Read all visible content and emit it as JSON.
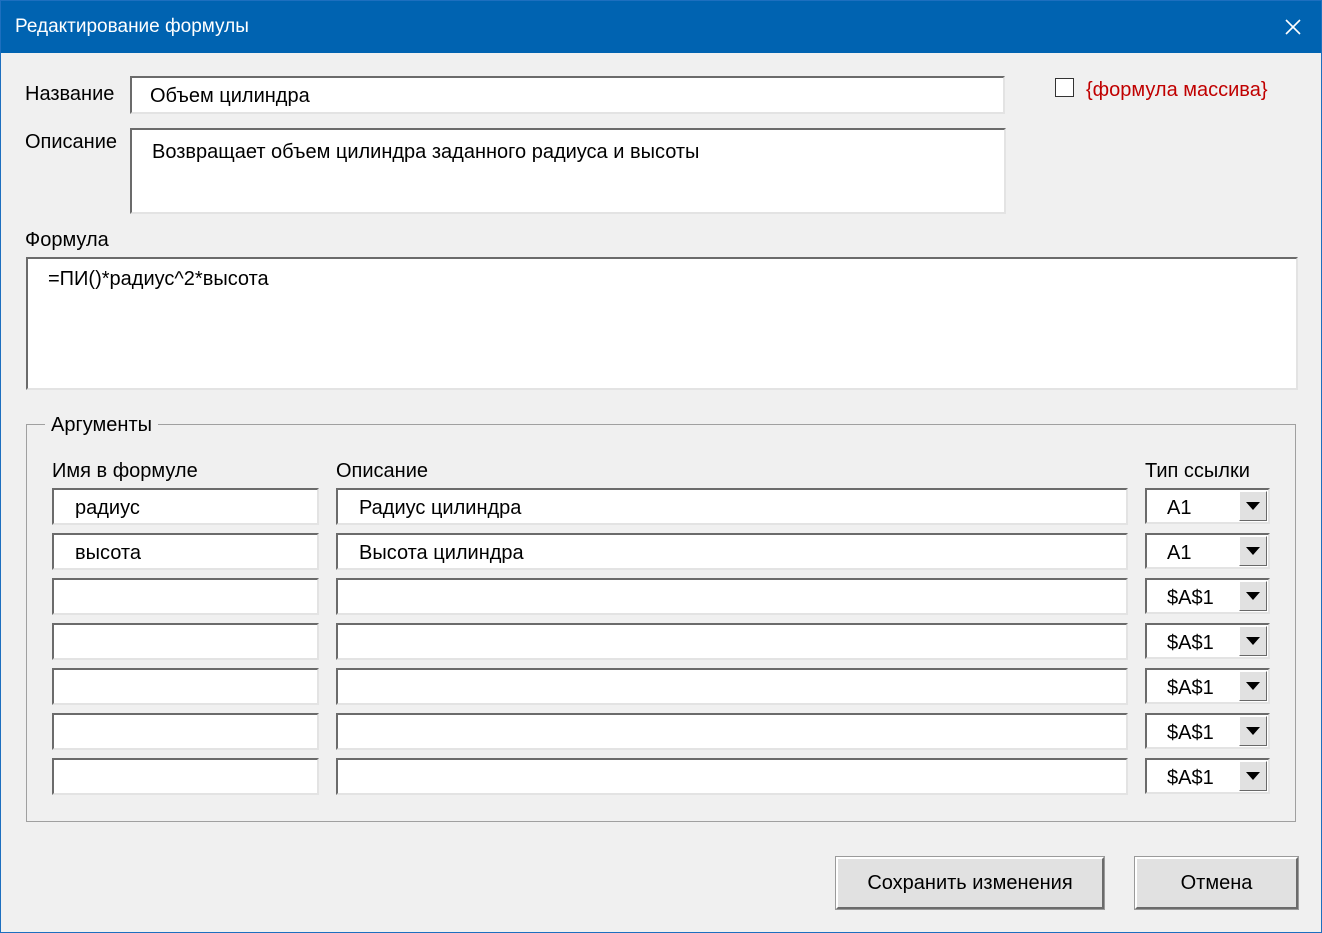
{
  "window": {
    "title": "Редактирование формулы"
  },
  "name_field": {
    "label": "Название",
    "value": "Объем цилиндра"
  },
  "description_field": {
    "label": "Описание",
    "value": "Возвращает объем цилиндра заданного радиуса и высоты"
  },
  "array_formula": {
    "label": "{формула массива}",
    "checked": false,
    "color": "#c00000"
  },
  "formula_field": {
    "label": "Формула",
    "value": "=ПИ()*радиус^2*высота"
  },
  "arguments": {
    "title": "Аргументы",
    "columns": {
      "name": "Имя в формуле",
      "description": "Описание",
      "ref_type": "Тип ссылки"
    },
    "rows": [
      {
        "name": "радиус",
        "description": "Радиус цилиндра",
        "ref_type": "A1"
      },
      {
        "name": "высота",
        "description": "Высота цилиндра",
        "ref_type": "A1"
      },
      {
        "name": "",
        "description": "",
        "ref_type": "$A$1"
      },
      {
        "name": "",
        "description": "",
        "ref_type": "$A$1"
      },
      {
        "name": "",
        "description": "",
        "ref_type": "$A$1"
      },
      {
        "name": "",
        "description": "",
        "ref_type": "$A$1"
      },
      {
        "name": "",
        "description": "",
        "ref_type": "$A$1"
      }
    ]
  },
  "buttons": {
    "save": "Сохранить изменения",
    "cancel": "Отмена"
  },
  "colors": {
    "titlebar": "#0063b1",
    "background": "#f0f0f0"
  }
}
